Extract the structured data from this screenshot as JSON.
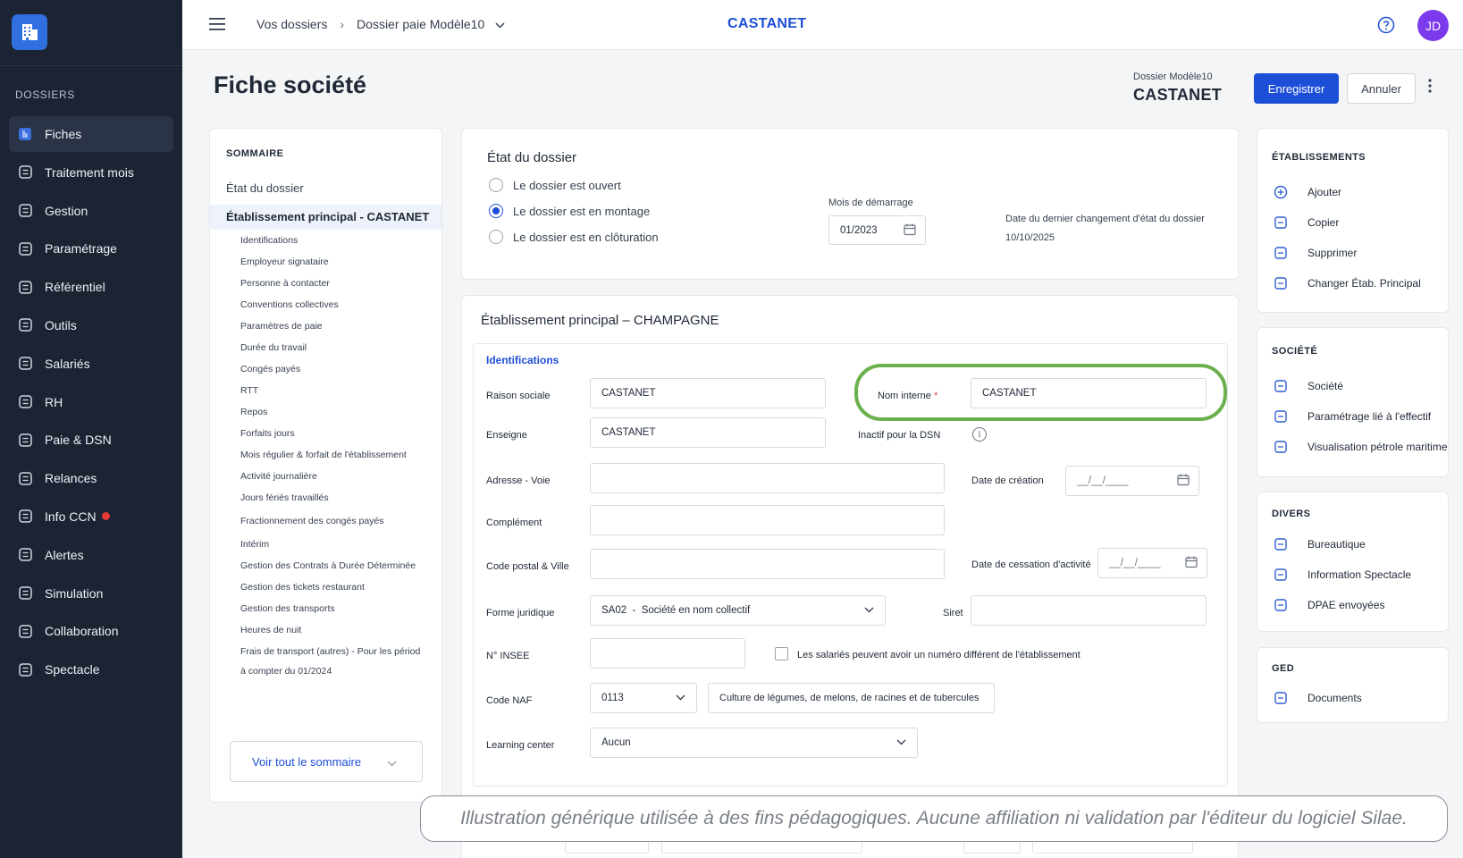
{
  "sidebar": {
    "heading": "DOSSIERS",
    "items": [
      {
        "label": "Fiches",
        "icon": "fiches-icon",
        "active": true
      },
      {
        "label": "Traitement mois",
        "icon": "calculator-icon"
      },
      {
        "label": "Gestion",
        "icon": "gear-icon"
      },
      {
        "label": "Paramétrage",
        "icon": "settings-icon"
      },
      {
        "label": "Référentiel",
        "icon": "book-icon"
      },
      {
        "label": "Outils",
        "icon": "tools-icon"
      },
      {
        "label": "Salariés",
        "icon": "users-icon"
      },
      {
        "label": "RH",
        "icon": "hr-icon"
      },
      {
        "label": "Paie & DSN",
        "icon": "document-icon"
      },
      {
        "label": "Relances",
        "icon": "reminder-icon"
      },
      {
        "label": "Info CCN",
        "icon": "info-icon",
        "badge": true
      },
      {
        "label": "Alertes",
        "icon": "bell-icon"
      },
      {
        "label": "Simulation",
        "icon": "simulation-icon"
      },
      {
        "label": "Collaboration",
        "icon": "collaboration-icon"
      },
      {
        "label": "Spectacle",
        "icon": "spectacle-icon"
      }
    ]
  },
  "topbar": {
    "breadcrumb_root": "Vos dossiers",
    "breadcrumb_current": "Dossier paie Modèle10",
    "title": "CASTANET",
    "avatar": "JD"
  },
  "header": {
    "page_title": "Fiche société",
    "dossier_label": "Dossier Modèle10",
    "dossier_name": "CASTANET",
    "save": "Enregistrer",
    "cancel": "Annuler"
  },
  "summary": {
    "heading": "SOMMAIRE",
    "etat": "État du dossier",
    "active": "Établissement principal - CASTANET",
    "items": [
      "Identifications",
      "Employeur signataire",
      "Personne à contacter",
      "Conventions collectives",
      "Paramètres de paie",
      "Durée du travail",
      "Congés payés",
      "RTT",
      "Repos",
      "Forfaits jours",
      "Mois régulier & forfait de l'établissement",
      "Activité journalière",
      "Jours fériés travaillés",
      "Fractionnement des congés payés",
      "Intérim",
      "Gestion des Contrats à Durée Déterminée",
      "Gestion des tickets restaurant",
      "Gestion des transports",
      "Heures de nuit",
      "Frais de transport (autres) - Pour les périod",
      "à compter du 01/2024"
    ],
    "see_all": "Voir tout le sommaire"
  },
  "etat": {
    "title": "État du dossier",
    "options": [
      "Le dossier est ouvert",
      "Le dossier est en montage",
      "Le dossier est en clôturation"
    ],
    "selected_index": 1,
    "mois_label": "Mois de démarrage",
    "mois_value": "01/2023",
    "date_label": "Date du dernier changement d'état du dossier",
    "date_value": "10/10/2025"
  },
  "etab": {
    "title": "Établissement principal – CHAMPAGNE",
    "section": "Identifications",
    "raison_label": "Raison sociale",
    "raison_value": "CASTANET",
    "nom_label": "Nom interne",
    "nom_required": "*",
    "nom_value": "CASTANET",
    "enseigne_label": "Enseigne",
    "enseigne_value": "CASTANET",
    "inactif_label": "Inactif pour la DSN",
    "adresse_label": "Adresse - Voie",
    "creation_label": "Date de création",
    "creation_placeholder": "__/__/____",
    "complement_label": "Complément",
    "cp_label": "Code postal & Ville",
    "cessation_label": "Date de cessation d'activité",
    "cessation_placeholder": "__/__/____",
    "forme_label": "Forme juridique",
    "forme_value": "SA02  -  Société en nom collectif",
    "siret_label": "Siret",
    "insee_label": "N° INSEE",
    "checkbox_label": "Les salariés peuvent avoir un numéro différent de l'établissement",
    "naf_label": "Code NAF",
    "naf_value": "0113",
    "naf_desc": "Culture de légumes, de melons, de racines et de tubercules",
    "learning_label": "Learning center",
    "learning_value": "Aucun"
  },
  "right": {
    "etab_heading": "ÉTABLISSEMENTS",
    "etab_items": [
      {
        "label": "Ajouter",
        "icon": "plus-circle-icon"
      },
      {
        "label": "Copier",
        "icon": "copy-icon"
      },
      {
        "label": "Supprimer",
        "icon": "delete-icon"
      },
      {
        "label": "Changer Étab. Principal",
        "icon": "switch-icon"
      }
    ],
    "societe_heading": "SOCIÉTÉ",
    "societe_items": [
      {
        "label": "Société",
        "icon": "company-icon"
      },
      {
        "label": "Paramétrage lié à l'effectif",
        "icon": "effectif-icon"
      },
      {
        "label": "Visualisation pétrole maritime",
        "icon": "ship-icon"
      }
    ],
    "divers_heading": "DIVERS",
    "divers_items": [
      {
        "label": "Bureautique",
        "icon": "office-icon"
      },
      {
        "label": "Information Spectacle",
        "icon": "spectacle-book-icon"
      },
      {
        "label": "DPAE envoyées",
        "icon": "dpae-icon"
      }
    ],
    "ged_heading": "GED",
    "ged_items": [
      {
        "label": "Documents",
        "icon": "folder-icon"
      }
    ]
  },
  "disclaimer": "Illustration générique utilisée à des fins pédagogiques. Aucune affiliation ni validation par l'éditeur du logiciel Silae.",
  "colors": {
    "sidebar": "#1c2434",
    "accent": "#1d4ed8",
    "highlight": "#6ab04c",
    "avatar": "#7c3aed"
  }
}
